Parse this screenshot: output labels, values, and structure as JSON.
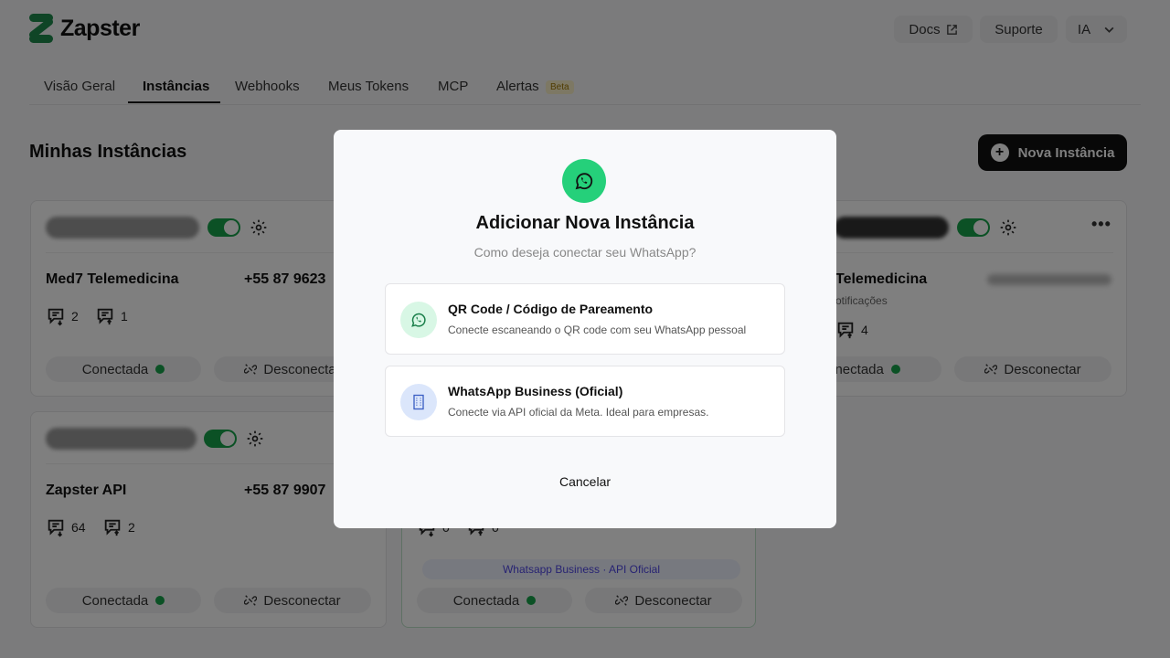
{
  "brand": {
    "name": "Zapster"
  },
  "header": {
    "docs": "Docs",
    "support": "Suporte",
    "user": "IA"
  },
  "tabs": [
    {
      "label": "Visão Geral"
    },
    {
      "label": "Instâncias"
    },
    {
      "label": "Webhooks"
    },
    {
      "label": "Meus Tokens"
    },
    {
      "label": "MCP"
    },
    {
      "label": "Alertas"
    }
  ],
  "beta_badge": "Beta",
  "page": {
    "title": "Minhas Instâncias",
    "new_button": "Nova Instância"
  },
  "cards": [
    {
      "name": "Med7 Telemedicina",
      "phone": "+55 87 9623",
      "received": "2",
      "sent": "1",
      "status": "Conectada",
      "disconnect": "Desconectar"
    },
    {
      "name": "Zapster API",
      "phone": "+55 87 9907",
      "received": "64",
      "sent": "2",
      "status": "Conectada",
      "disconnect": "Desconectar"
    },
    {
      "name": "Telemedicina",
      "subtitle": "otificações",
      "sent": "4",
      "status": "onectada",
      "disconnect": "Desconectar"
    },
    {
      "received": "0",
      "sent": "0",
      "badge": "Whatsapp Business · API Oficial",
      "status": "Conectada",
      "disconnect": "Desconectar"
    }
  ],
  "modal": {
    "title": "Adicionar Nova Instância",
    "subtitle": "Como deseja conectar seu WhatsApp?",
    "options": [
      {
        "title": "QR Code / Código de Pareamento",
        "description": "Conecte escaneando o QR code com seu WhatsApp pessoal",
        "icon": "whatsapp-icon"
      },
      {
        "title": "WhatsApp Business (Oficial)",
        "description": "Conecte via API oficial da Meta. Ideal para empresas.",
        "icon": "building-icon"
      }
    ],
    "cancel": "Cancelar"
  },
  "colors": {
    "brand_green": "#25d07a",
    "status_green": "#16a34a",
    "api_badge": "#4f46e5"
  }
}
